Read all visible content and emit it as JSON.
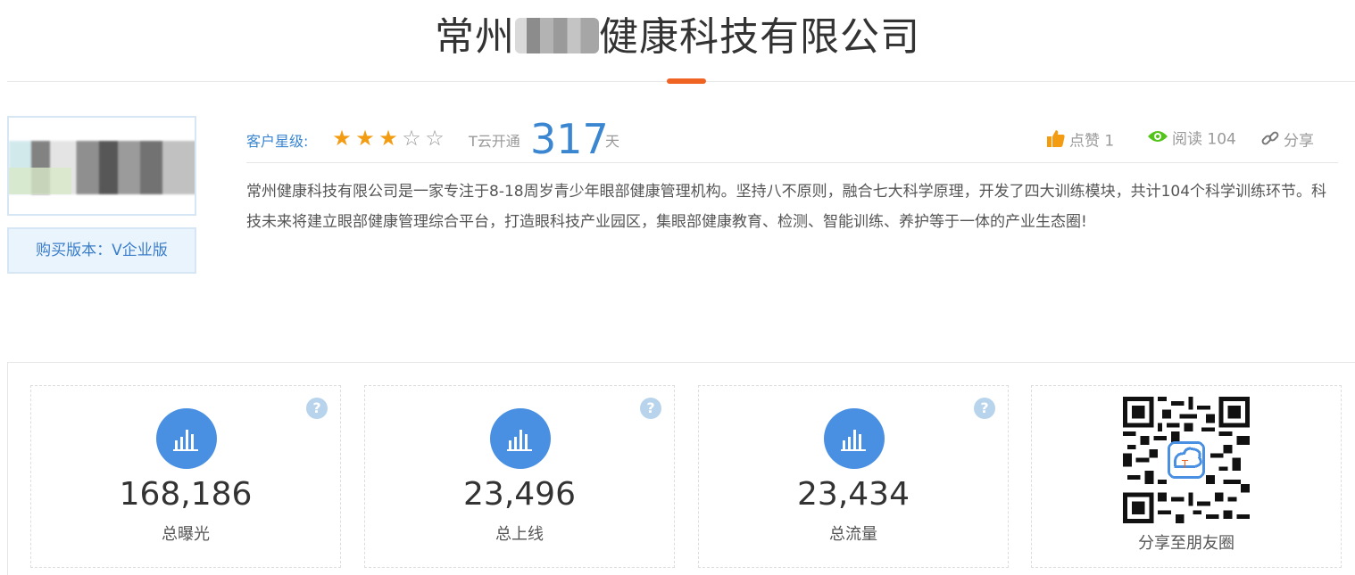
{
  "header": {
    "title_prefix": "常州",
    "title_suffix": "健康科技有限公司"
  },
  "profile": {
    "version_label": "购买版本：V企业版"
  },
  "meta": {
    "star_label": "客户星级:",
    "stars_filled": 3,
    "stars_total": 5,
    "tyun_label": "T云开通",
    "days": "317",
    "days_unit": "天",
    "like_label": "点赞 1",
    "read_label": "阅读 104",
    "share_label": "分享"
  },
  "description": "常州健康科技有限公司是一家专注于8-18周岁青少年眼部健康管理机构。坚持八不原则，融合七大科学原理，开发了四大训练模块，共计104个科学训练环节。科技未来将建立眼部健康管理综合平台，打造眼科技产业园区，集眼部健康教育、检测、智能训练、养护等于一体的产业生态圈!",
  "stats": [
    {
      "value": "168,186",
      "label": "总曝光"
    },
    {
      "value": "23,496",
      "label": "总上线"
    },
    {
      "value": "23,434",
      "label": "总流量"
    }
  ],
  "qr": {
    "label": "分享至朋友圈"
  },
  "colors": {
    "accent": "#f06423",
    "primary": "#4a90e2",
    "star": "#f39c12"
  }
}
